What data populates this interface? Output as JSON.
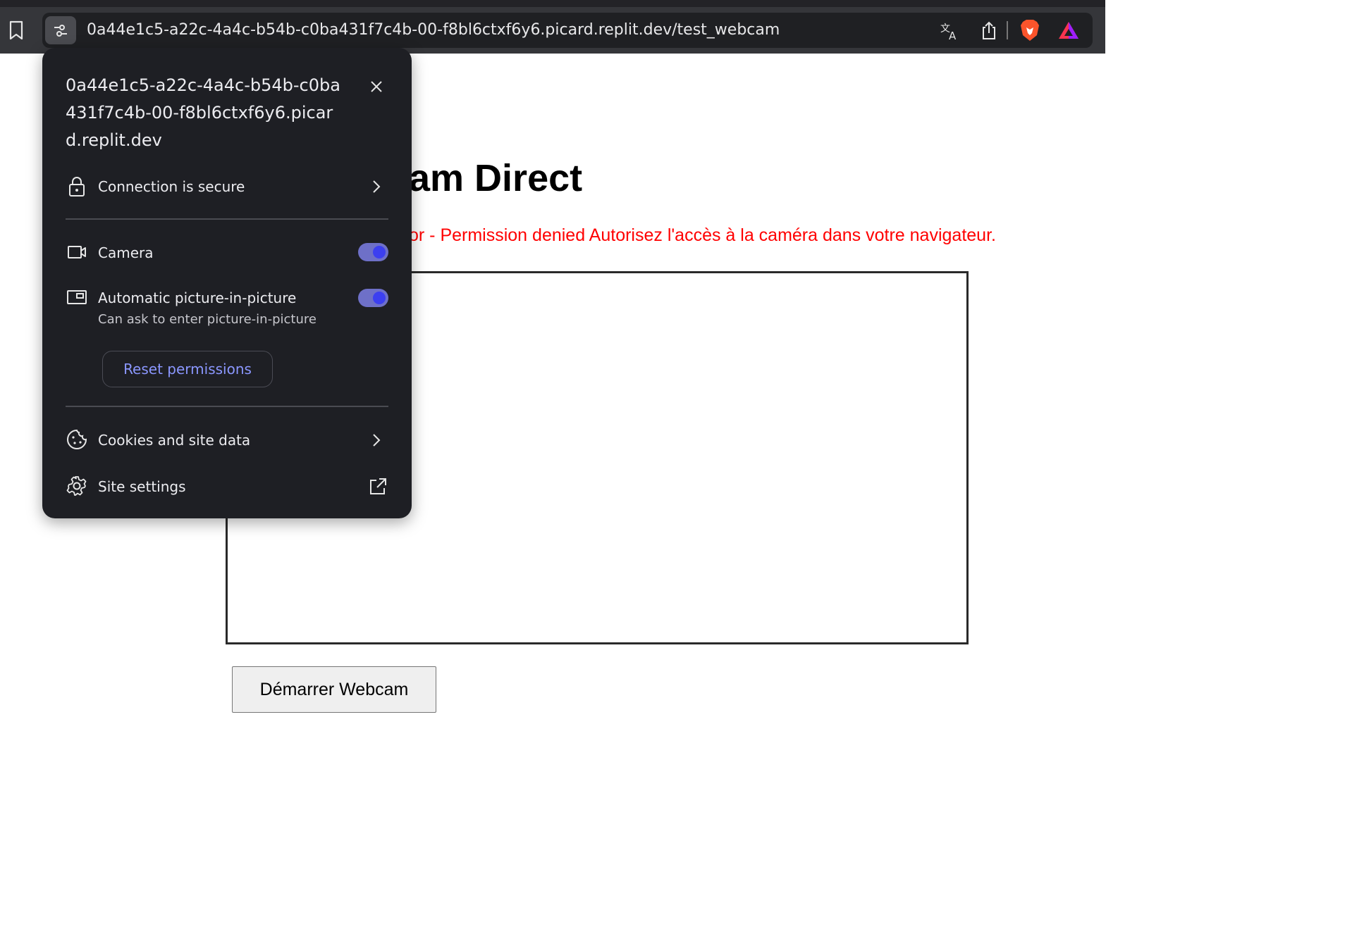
{
  "browser": {
    "url": "0a44e1c5-a22c-4a4c-b54b-c0ba431f7c4b-00-f8bl6ctxf6y6.picard.replit.dev/test_webcam",
    "icons": [
      "bookmark-icon",
      "site-info-icon",
      "translate-icon",
      "share-icon",
      "brave-shields-icon",
      "brave-rewards-icon"
    ]
  },
  "page": {
    "title": "am Direct",
    "error": "or - Permission denied Autorisez l'accès à la caméra dans votre navigateur.",
    "start_button": "Démarrer Webcam",
    "error_color": "#ff0000"
  },
  "popup": {
    "site": "0a44e1c5-a22c-4a4c-b54b-c0ba431f7c4b-00-f8bl6ctxf6y6.picard.replit.dev",
    "connection_label": "Connection is secure",
    "camera_label": "Camera",
    "camera_enabled": true,
    "pip_label": "Automatic picture-in-picture",
    "pip_sub": "Can ask to enter picture-in-picture",
    "pip_enabled": true,
    "reset_label": "Reset permissions",
    "cookies_label": "Cookies and site data",
    "settings_label": "Site settings",
    "accent_color": "#8b97ff"
  }
}
